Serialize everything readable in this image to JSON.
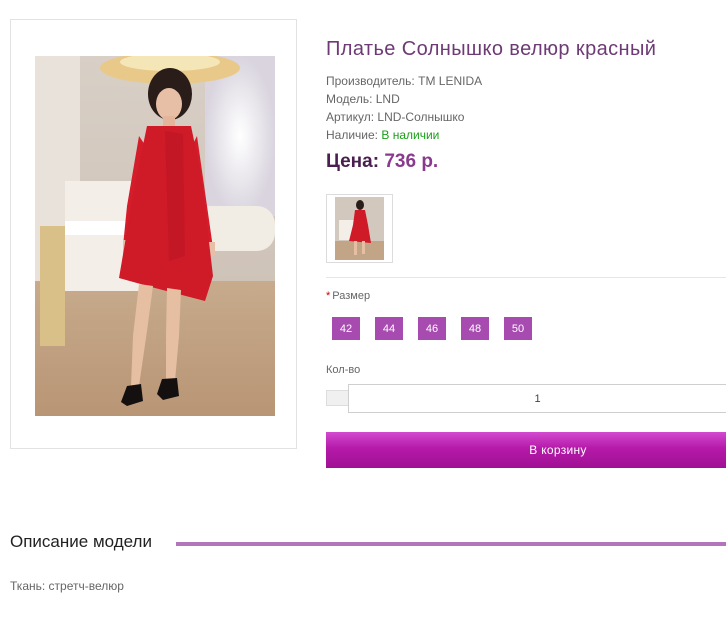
{
  "product": {
    "title": "Платье Солнышко велюр красный",
    "manufacturer_label": "Производитель:",
    "manufacturer": "ТМ LENIDA",
    "model_label": "Модель:",
    "model": "LND",
    "sku_label": "Артикул:",
    "sku": "LND-Солнышко",
    "availability_label": "Наличие:",
    "availability": "В наличии",
    "price_label": "Цена:",
    "price": "736 р."
  },
  "options": {
    "size_required_mark": "*",
    "size_label": "Размер",
    "sizes": [
      "42",
      "44",
      "46",
      "48",
      "50"
    ]
  },
  "quantity": {
    "label": "Кол-во",
    "value": "1"
  },
  "cart_button": "В корзину",
  "description": {
    "title": "Описание модели",
    "text": "Ткань: стретч-велюр"
  },
  "colors": {
    "accent_purple": "#a74bb1",
    "title_purple": "#6e3a75",
    "button_magenta": "#b51aa8",
    "in_stock_green": "#18a018"
  }
}
